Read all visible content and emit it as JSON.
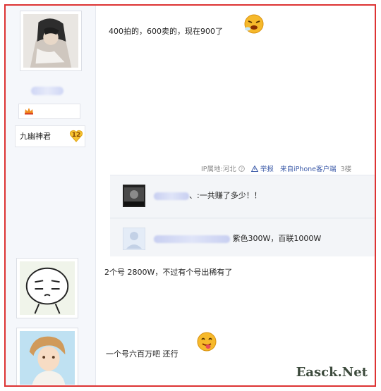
{
  "posts": [
    {
      "text": "400拍的，600卖的，现在900了",
      "user": {
        "name": "九幽神君",
        "level": "12"
      },
      "meta": {
        "ip_label": "IP属地:河北",
        "report_label": "举报",
        "device_label": "来自iPhone客户端",
        "floor_label": "3楼"
      },
      "replies": [
        {
          "name_suffix": "、",
          "text": ":一共赚了多少！！"
        },
        {
          "text": "紫色300W，百联1000W"
        }
      ]
    },
    {
      "text": "2个号 2800W，不过有个号出稀有了"
    },
    {
      "text": "一个号六百万吧 还行"
    }
  ],
  "watermark": "Easck.Net",
  "icons": {
    "help": "question-circle-icon",
    "report": "warning-triangle-icon",
    "emoji_angry": "angry-emoji-icon",
    "emoji_tongue": "tongue-emoji-icon"
  },
  "colors": {
    "frame_border": "#dd3333",
    "link": "#3b5aa8",
    "left_column_bg": "#f5f7fb",
    "reply_bg": "#f3f5f8"
  }
}
